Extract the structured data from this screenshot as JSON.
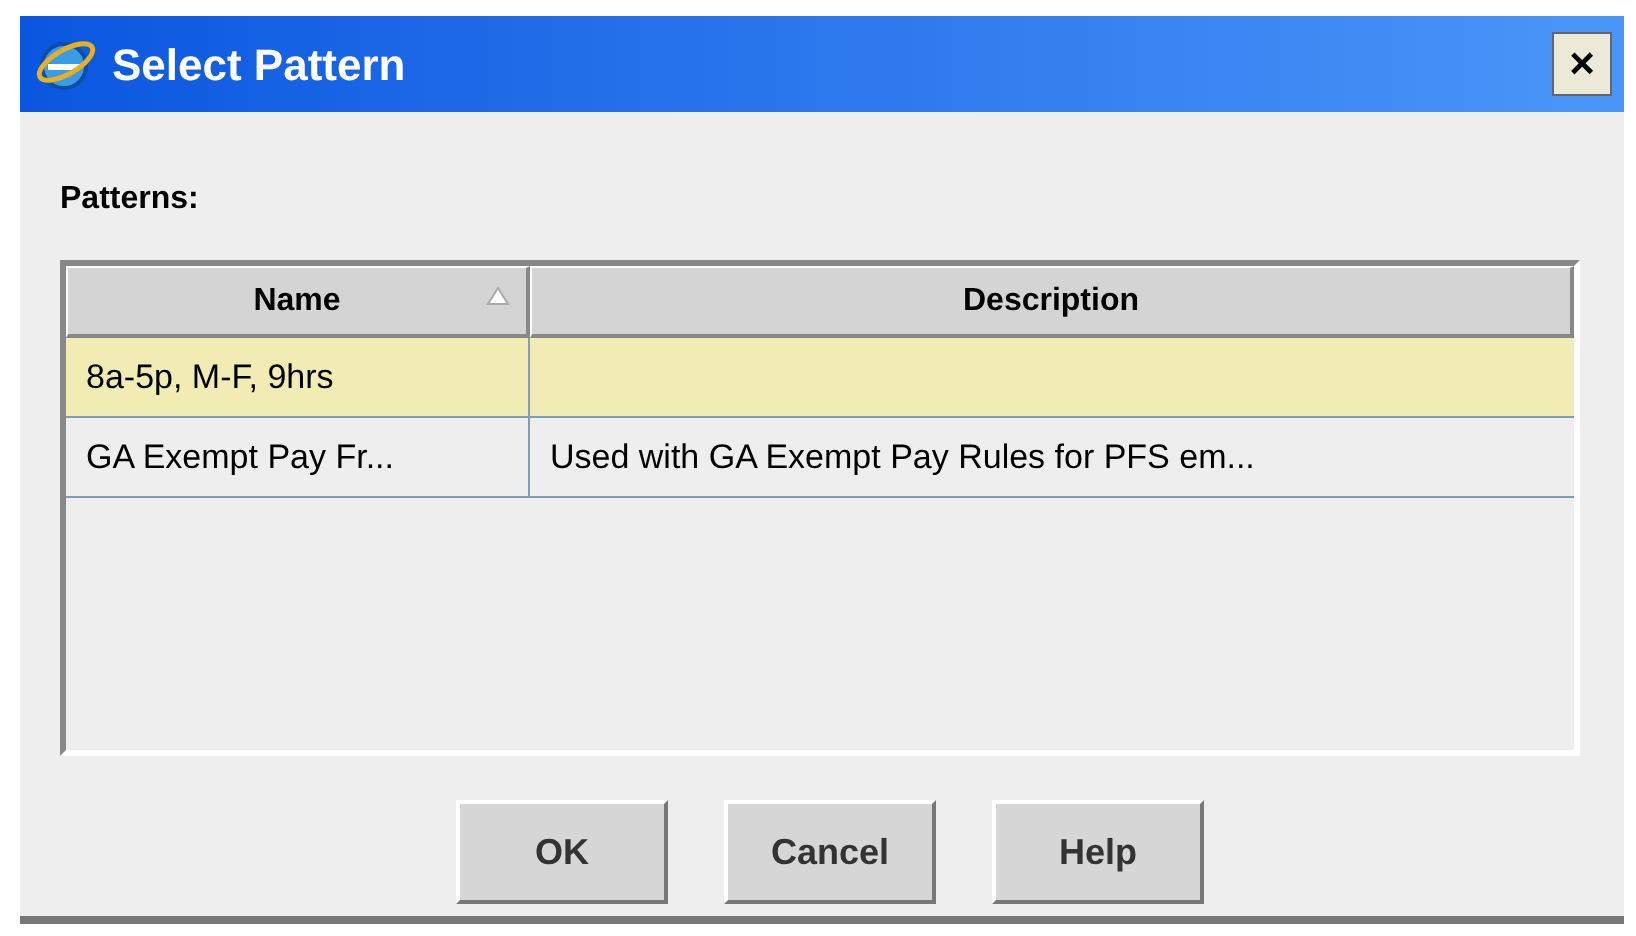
{
  "window": {
    "title": "Select Pattern",
    "close": "×"
  },
  "label": "Patterns:",
  "table": {
    "columns": [
      "Name",
      "Description"
    ],
    "rows": [
      {
        "cells": [
          "8a-5p, M-F, 9hrs",
          ""
        ],
        "selected": true
      },
      {
        "cells": [
          "GA Exempt Pay Fr...",
          "Used with GA Exempt Pay Rules for PFS em..."
        ],
        "selected": false
      }
    ]
  },
  "buttons": [
    "OK",
    "Cancel",
    "Help"
  ]
}
